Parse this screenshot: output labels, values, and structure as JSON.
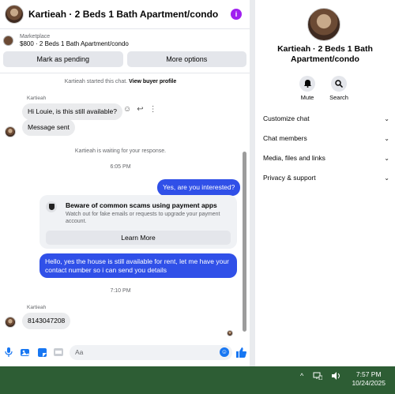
{
  "header": {
    "title": "Kartieah · 2 Beds 1 Bath Apartment/condo"
  },
  "listing": {
    "category": "Marketplace",
    "title": "$800 · 2 Beds 1 Bath Apartment/condo"
  },
  "actions": {
    "pending": "Mark as pending",
    "more": "More options"
  },
  "messages": {
    "started": "Kartieah started this chat.",
    "view_profile": "View buyer profile",
    "sender1": "Kartieah",
    "msg1": "Hi Louie, is this still available?",
    "msg2": "Message sent",
    "waiting": "Kartieah is waiting for your response.",
    "time1": "6:05 PM",
    "out1": "Yes, are you interested?",
    "warn_title": "Beware of common scams using payment apps",
    "warn_body": "Watch out for fake emails or requests to upgrade your payment account.",
    "learn_more": "Learn More",
    "out2": "Hello, yes the house is still available for rent, let me have your contact number so i can send you details",
    "time2": "7:10 PM",
    "sender2": "Kartieah",
    "msg3": "8143047208"
  },
  "composer": {
    "placeholder": "Aa"
  },
  "side": {
    "name": "Kartieah · 2 Beds 1 Bath Apartment/condo",
    "mute": "Mute",
    "search": "Search",
    "rows": [
      "Customize chat",
      "Chat members",
      "Media, files and links",
      "Privacy & support"
    ]
  },
  "taskbar": {
    "time": "7:57 PM",
    "date": "10/24/2025"
  },
  "colors": {
    "accent": "#3050e8",
    "info": "#a020f0",
    "taskbar": "#2d5d34"
  }
}
